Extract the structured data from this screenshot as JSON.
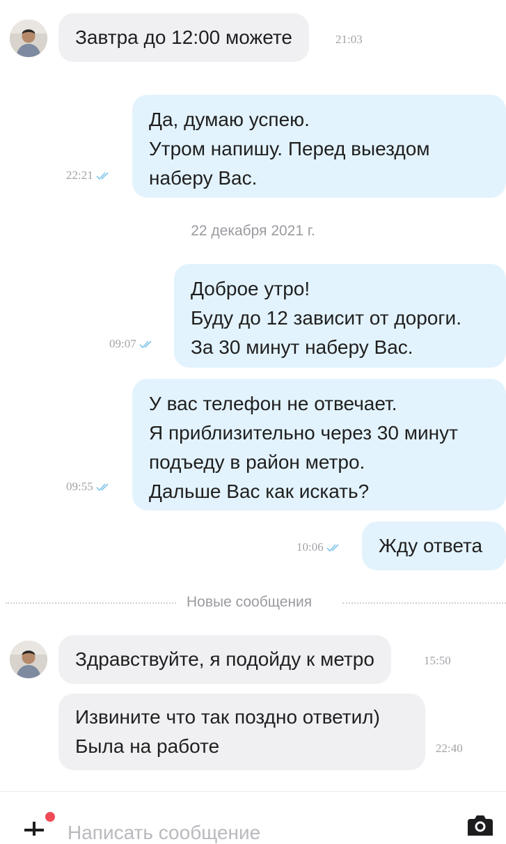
{
  "messages": [
    {
      "lines": [
        "Завтра до 12:00 можете"
      ],
      "time": "21:03"
    },
    {
      "lines": [
        "Да, думаю успею.",
        "Утром напишу. Перед выездом",
        "наберу Вас."
      ],
      "time": "22:21"
    },
    {
      "lines": [
        "Доброе утро!",
        "Буду до 12 зависит от дороги.",
        "За 30 минут наберу Вас."
      ],
      "time": "09:07"
    },
    {
      "lines": [
        "У вас телефон не отвечает.",
        "Я приблизительно через 30 минут",
        "подъеду в район метро.",
        "Дальше Вас как искать?"
      ],
      "time": "09:55"
    },
    {
      "lines": [
        "Жду ответа"
      ],
      "time": "10:06"
    },
    {
      "lines": [
        "Здравствуйте, я подойду к метро"
      ],
      "time": "15:50"
    },
    {
      "lines": [
        "Извините что так поздно ответил)",
        "Была на работе"
      ],
      "time": "22:40"
    }
  ],
  "date_separator": "22 декабря 2021 г.",
  "new_messages_label": "Новые сообщения",
  "composer": {
    "placeholder": "Написать сообщение"
  },
  "icons": {
    "attach": "plus-icon",
    "attach_badge": "notification-dot",
    "camera": "camera-icon",
    "read_status": "double-check-icon"
  },
  "colors": {
    "incoming_bubble": "#f0f0f3",
    "outgoing_bubble": "#e3f3fd",
    "read_ticks": "#7fc4ea",
    "badge": "#f04a56"
  }
}
